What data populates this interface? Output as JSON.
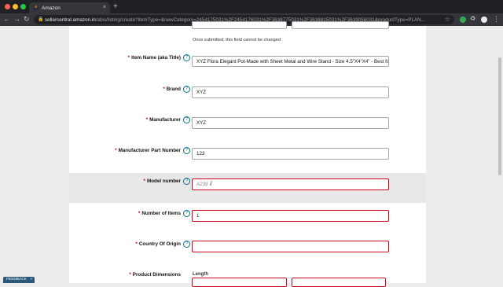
{
  "browser": {
    "tab_title": "Amazon",
    "tab_favicon": "a",
    "tab_close": "×",
    "new_tab": "+",
    "url_host": "sellercentral.amazon.in",
    "url_path": "/abis/listing/create?itemType=&newCategory=2454175031%2F2454176031%2F3638775031%2F3638815031%2F3639058031&productType=PLAN..."
  },
  "form": {
    "top_note": "Once submitted, this field cannot be changed",
    "fields": [
      {
        "label": "Item Name (aka Title)",
        "value": "XYZ Flora Elegant Pot-Made with Sheet Metal and Wire Stand - Size 4.5\"X4\"X4\" - Best for Co"
      },
      {
        "label": "Brand",
        "value": "XYZ"
      },
      {
        "label": "Manufacturer",
        "value": "XYZ"
      },
      {
        "label": "Manufacturer Part Number",
        "value": "123"
      },
      {
        "label": "Model number",
        "value": "A239"
      },
      {
        "label": "Number of Items",
        "value": "1"
      },
      {
        "label": "Country Of Origin",
        "value": ""
      },
      {
        "label": "Product Dimensions",
        "sub_label": "Length"
      }
    ],
    "required_mark": "*",
    "help_glyph": "?"
  },
  "feedback": {
    "label": "FEEDBACK",
    "close": "×"
  },
  "colors": {
    "error_border": "#d0021b",
    "help_blue": "#007185",
    "required_red": "#c40000"
  }
}
